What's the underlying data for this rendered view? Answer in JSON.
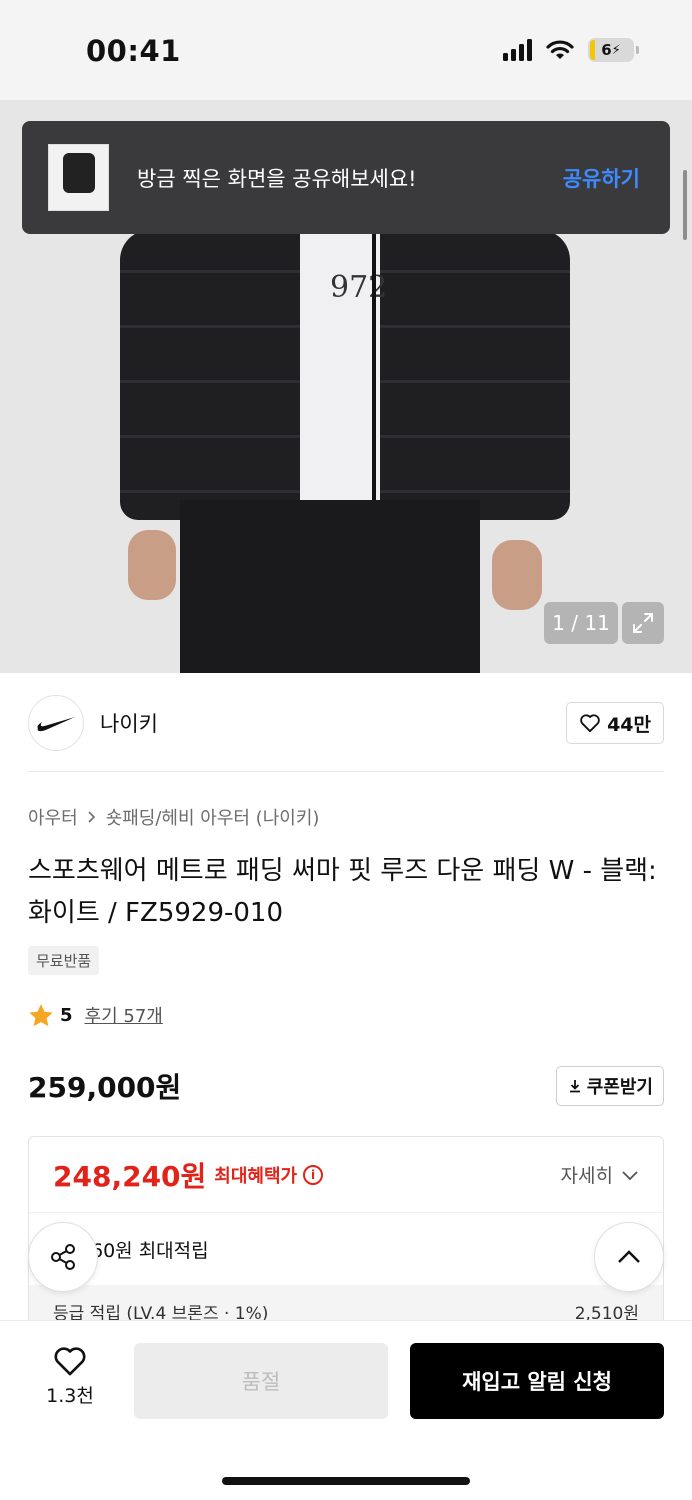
{
  "status_bar": {
    "time": "00:41",
    "battery": "6"
  },
  "toast": {
    "message": "방금 찍은 화면을 공유해보세요!",
    "action": "공유하기"
  },
  "gallery": {
    "print_text": "972",
    "counter": "1 / 11",
    "expand_icon": "expand-icon"
  },
  "brand": {
    "name": "나이키",
    "likes": "44만"
  },
  "breadcrumb": {
    "level1": "아우터",
    "level2": "숏패딩/헤비 아우터 (나이키)"
  },
  "product": {
    "title": "스포츠웨어 메트로 패딩 써마 핏 루즈 다운 패딩 W - 블랙:화이트 / FZ5929-010",
    "tag": "무료반품",
    "rating": "5",
    "review": "후기 57개",
    "price": "259,000원",
    "coupon_label": "쿠폰받기"
  },
  "benefit": {
    "price": "248,240원",
    "label": "최대혜택가",
    "info_glyph": "i",
    "detail": "자세히",
    "points": "60원 최대적립",
    "grade_label": "등급 적립 (LV.4 브론즈 · 1%)",
    "grade_value": "2,510원"
  },
  "bottom": {
    "wish_count": "1.3천",
    "soldout_label": "품절",
    "restock_label": "재입고 알림 신청"
  },
  "colors": {
    "accent_red": "#e2231a",
    "toast_bg": "#3a3a3c",
    "link_blue": "#3d8bff"
  }
}
